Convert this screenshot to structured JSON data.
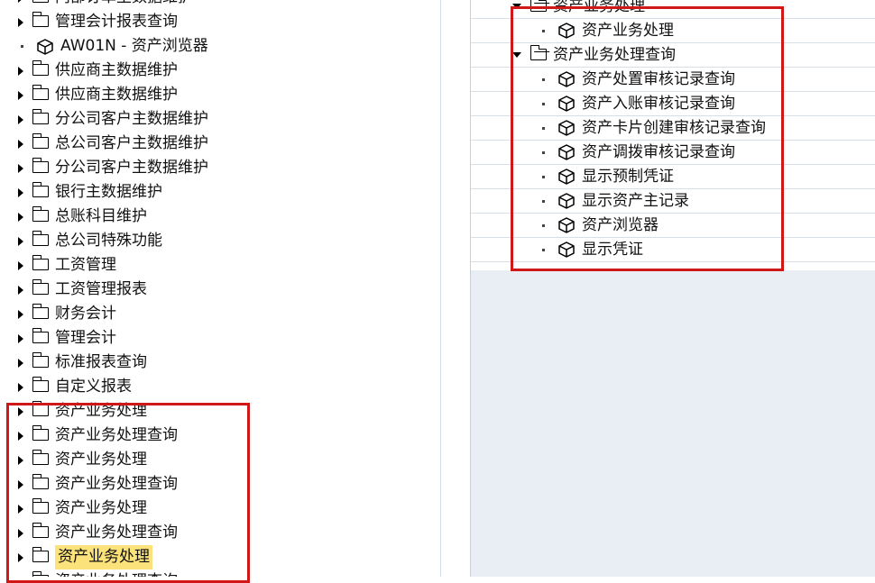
{
  "left_tree": {
    "items": [
      {
        "label": "内部订单主数据维护",
        "type": "folder"
      },
      {
        "label": "管理会计报表查询",
        "type": "folder"
      },
      {
        "label": "AW01N - 资产浏览器",
        "type": "transaction"
      },
      {
        "label": "供应商主数据维护",
        "type": "folder"
      },
      {
        "label": "供应商主数据维护",
        "type": "folder"
      },
      {
        "label": "分公司客户主数据维护",
        "type": "folder"
      },
      {
        "label": "总公司客户主数据维护",
        "type": "folder"
      },
      {
        "label": "分公司客户主数据维护",
        "type": "folder"
      },
      {
        "label": "银行主数据维护",
        "type": "folder"
      },
      {
        "label": "总账科目维护",
        "type": "folder"
      },
      {
        "label": "总公司特殊功能",
        "type": "folder"
      },
      {
        "label": "工资管理",
        "type": "folder"
      },
      {
        "label": "工资管理报表",
        "type": "folder"
      },
      {
        "label": "财务会计",
        "type": "folder"
      },
      {
        "label": "管理会计",
        "type": "folder"
      },
      {
        "label": "标准报表查询",
        "type": "folder"
      },
      {
        "label": "自定义报表",
        "type": "folder"
      },
      {
        "label": "资产业务处理",
        "type": "folder"
      },
      {
        "label": "资产业务处理查询",
        "type": "folder"
      },
      {
        "label": "资产业务处理",
        "type": "folder"
      },
      {
        "label": "资产业务处理查询",
        "type": "folder"
      },
      {
        "label": "资产业务处理",
        "type": "folder"
      },
      {
        "label": "资产业务处理查询",
        "type": "folder"
      },
      {
        "label": "资产业务处理",
        "type": "folder",
        "selected": true
      },
      {
        "label": "资产业务处理查询",
        "type": "folder"
      }
    ]
  },
  "right_tree": {
    "items": [
      {
        "label": "资产业务处理",
        "type": "open-folder"
      },
      {
        "label": "资产业务处理",
        "type": "transaction"
      },
      {
        "label": "资产业务处理查询",
        "type": "open-folder"
      },
      {
        "label": "资产处置审核记录查询",
        "type": "transaction"
      },
      {
        "label": "资产入账审核记录查询",
        "type": "transaction"
      },
      {
        "label": "资产卡片创建审核记录查询",
        "type": "transaction"
      },
      {
        "label": "资产调拨审核记录查询",
        "type": "transaction"
      },
      {
        "label": "显示预制凭证",
        "type": "transaction"
      },
      {
        "label": "显示资产主记录",
        "type": "transaction"
      },
      {
        "label": "资产浏览器",
        "type": "transaction"
      },
      {
        "label": "显示凭证",
        "type": "transaction"
      }
    ]
  },
  "colors": {
    "highlight_box": "#d01818",
    "selection": "#fbe27a",
    "pane_background": "#e9eef5"
  }
}
